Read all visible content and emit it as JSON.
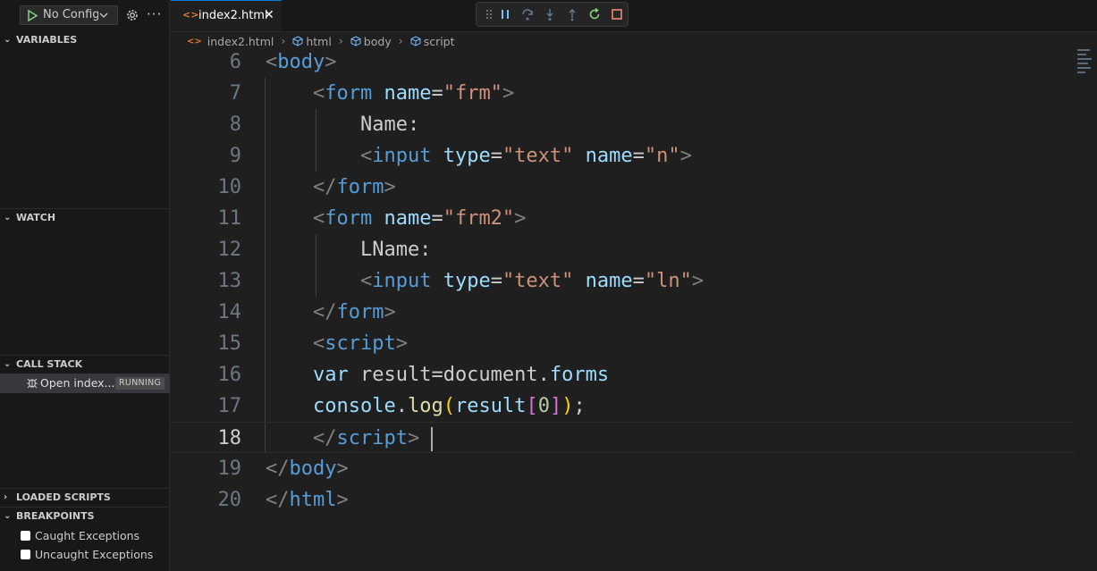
{
  "sidebar": {
    "config_label": "No Configu",
    "sections": {
      "variables": "VARIABLES",
      "watch": "WATCH",
      "call_stack": "CALL STACK",
      "loaded_scripts": "LOADED SCRIPTS",
      "breakpoints": "BREAKPOINTS"
    },
    "call_stack_item": {
      "label": "Open index...",
      "status": "RUNNING"
    },
    "breakpoint_items": [
      "Caught Exceptions",
      "Uncaught Exceptions"
    ]
  },
  "editor": {
    "tab_label": "index2.html",
    "breadcrumb": [
      "index2.html",
      "html",
      "body",
      "script"
    ],
    "current_line": 18,
    "lines": [
      {
        "n": "6",
        "tokens": [
          [
            "t-punc",
            "<"
          ],
          [
            "t-tag",
            "body"
          ],
          [
            "t-punc",
            ">"
          ]
        ]
      },
      {
        "n": "7",
        "tokens": [
          [
            "t-text",
            "    "
          ],
          [
            "t-punc",
            "<"
          ],
          [
            "t-tag",
            "form"
          ],
          [
            "t-text",
            " "
          ],
          [
            "t-attr",
            "name"
          ],
          [
            "t-text",
            "="
          ],
          [
            "t-str",
            "\"frm\""
          ],
          [
            "t-punc",
            ">"
          ]
        ]
      },
      {
        "n": "8",
        "tokens": [
          [
            "t-text",
            "        Name:"
          ]
        ]
      },
      {
        "n": "9",
        "tokens": [
          [
            "t-text",
            "        "
          ],
          [
            "t-punc",
            "<"
          ],
          [
            "t-tag",
            "input"
          ],
          [
            "t-text",
            " "
          ],
          [
            "t-attr",
            "type"
          ],
          [
            "t-text",
            "="
          ],
          [
            "t-str",
            "\"text\""
          ],
          [
            "t-text",
            " "
          ],
          [
            "t-attr",
            "name"
          ],
          [
            "t-text",
            "="
          ],
          [
            "t-str",
            "\"n\""
          ],
          [
            "t-punc",
            ">"
          ]
        ]
      },
      {
        "n": "10",
        "tokens": [
          [
            "t-text",
            "    "
          ],
          [
            "t-punc",
            "</"
          ],
          [
            "t-tag",
            "form"
          ],
          [
            "t-punc",
            ">"
          ]
        ]
      },
      {
        "n": "11",
        "tokens": [
          [
            "t-text",
            "    "
          ],
          [
            "t-punc",
            "<"
          ],
          [
            "t-tag",
            "form"
          ],
          [
            "t-text",
            " "
          ],
          [
            "t-attr",
            "name"
          ],
          [
            "t-text",
            "="
          ],
          [
            "t-str",
            "\"frm2\""
          ],
          [
            "t-punc",
            ">"
          ]
        ]
      },
      {
        "n": "12",
        "tokens": [
          [
            "t-text",
            "        LName:"
          ]
        ]
      },
      {
        "n": "13",
        "tokens": [
          [
            "t-text",
            "        "
          ],
          [
            "t-punc",
            "<"
          ],
          [
            "t-tag",
            "input"
          ],
          [
            "t-text",
            " "
          ],
          [
            "t-attr",
            "type"
          ],
          [
            "t-text",
            "="
          ],
          [
            "t-str",
            "\"text\""
          ],
          [
            "t-text",
            " "
          ],
          [
            "t-attr",
            "name"
          ],
          [
            "t-text",
            "="
          ],
          [
            "t-str",
            "\"ln\""
          ],
          [
            "t-punc",
            ">"
          ]
        ]
      },
      {
        "n": "14",
        "tokens": [
          [
            "t-text",
            "    "
          ],
          [
            "t-punc",
            "</"
          ],
          [
            "t-tag",
            "form"
          ],
          [
            "t-punc",
            ">"
          ]
        ]
      },
      {
        "n": "15",
        "tokens": [
          [
            "t-text",
            "    "
          ],
          [
            "t-punc",
            "<"
          ],
          [
            "t-tag",
            "script"
          ],
          [
            "t-punc",
            ">"
          ]
        ]
      },
      {
        "n": "16",
        "tokens": [
          [
            "t-text",
            "    "
          ],
          [
            "t-var",
            "var"
          ],
          [
            "t-text",
            " result=document."
          ],
          [
            "t-var",
            "forms"
          ]
        ]
      },
      {
        "n": "17",
        "tokens": [
          [
            "t-text",
            "    "
          ],
          [
            "t-var",
            "console"
          ],
          [
            "t-text",
            "."
          ],
          [
            "t-fn",
            "log"
          ],
          [
            "t-br1",
            "("
          ],
          [
            "t-var",
            "result"
          ],
          [
            "t-br2",
            "["
          ],
          [
            "t-num",
            "0"
          ],
          [
            "t-br2",
            "]"
          ],
          [
            "t-br1",
            ")"
          ],
          [
            "t-text",
            ";"
          ]
        ]
      },
      {
        "n": "18",
        "tokens": [
          [
            "t-text",
            "    "
          ],
          [
            "t-punc",
            "</"
          ],
          [
            "t-tag",
            "script"
          ],
          [
            "t-punc",
            ">"
          ]
        ]
      },
      {
        "n": "19",
        "tokens": [
          [
            "t-punc",
            "</"
          ],
          [
            "t-tag",
            "body"
          ],
          [
            "t-punc",
            ">"
          ]
        ]
      },
      {
        "n": "20",
        "tokens": [
          [
            "t-punc",
            "</"
          ],
          [
            "t-tag",
            "html"
          ],
          [
            "t-punc",
            ">"
          ]
        ]
      }
    ]
  },
  "debug_toolbar": {
    "buttons": [
      "drag-handle-icon",
      "pause-icon",
      "step-over-icon",
      "step-into-icon",
      "step-out-icon",
      "restart-icon",
      "stop-icon"
    ]
  },
  "colors": {
    "tag": "#569cd6",
    "attribute": "#9cdcfe",
    "string": "#ce9178",
    "accent": "#0078d4",
    "html_icon": "#e37933",
    "debug_icon": "#75beff",
    "restart": "#89d185",
    "stop": "#f48771"
  }
}
